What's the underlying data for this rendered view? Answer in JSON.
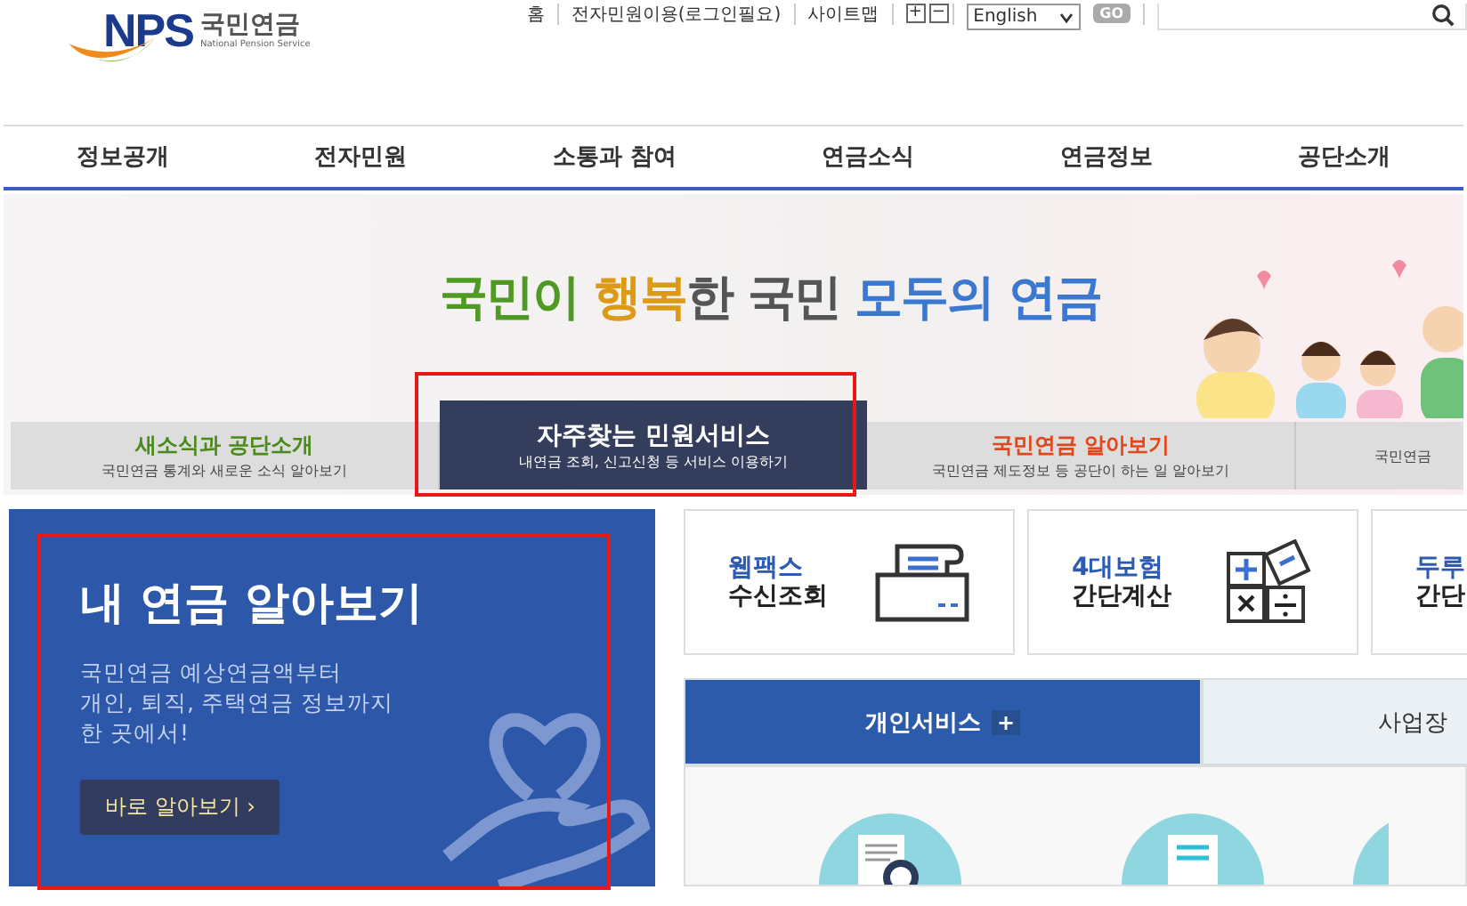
{
  "logo": {
    "abbr": "NPS",
    "name": "국민연금",
    "sub": "National Pension Service"
  },
  "utility_links": [
    "홈",
    "전자민원이용(로그인필요)",
    "사이트맵"
  ],
  "font_size_buttons": [
    "+",
    "−"
  ],
  "language_select": {
    "value": "English"
  },
  "go_button": "GO",
  "nav": [
    "정보공개",
    "전자민원",
    "소통과 참여",
    "연금소식",
    "연금정보",
    "공단소개"
  ],
  "slogan": [
    {
      "text": "국민이 ",
      "color": "#4f9a22"
    },
    {
      "text": "행복",
      "color": "#dc9a16"
    },
    {
      "text": "한 국민 ",
      "color": "#555555"
    },
    {
      "text": "모두의 연금",
      "color": "#3b78d0"
    }
  ],
  "banner_tabs": [
    {
      "title": "새소식과 공단소개",
      "sub": "국민연금 통계와 새로운 소식 알아보기",
      "selected": false,
      "color": "#4a8a1c"
    },
    {
      "title": "자주찾는 민원서비스",
      "sub": "내연금 조회, 신고신청 등 서비스 이용하기",
      "selected": true
    },
    {
      "title": "국민연금 알아보기",
      "sub": "국민연금 제도정보 등 공단이 하는 일 알아보기",
      "selected": false,
      "color": "#e0471a"
    },
    {
      "sub": "국민연금",
      "selected": false
    }
  ],
  "pension_card": {
    "title": "내 연금 알아보기",
    "body": [
      "국민연금 예상연금액부터",
      "개인, 퇴직, 주택연금 정보까지",
      "한 곳에서!"
    ],
    "button": "바로 알아보기 ›"
  },
  "quick_cards": [
    {
      "line1": "웹팩스",
      "line2": "수신조회",
      "kind": "fax"
    },
    {
      "line1": "4대보험",
      "line2": "간단계산",
      "kind": "calculator"
    },
    {
      "line1": "두루",
      "line2": "간단",
      "kind": "none"
    }
  ],
  "service_tabs": [
    {
      "label": "개인서비스",
      "selected": true,
      "plus": "+"
    },
    {
      "label": "사업장",
      "selected": false
    }
  ]
}
